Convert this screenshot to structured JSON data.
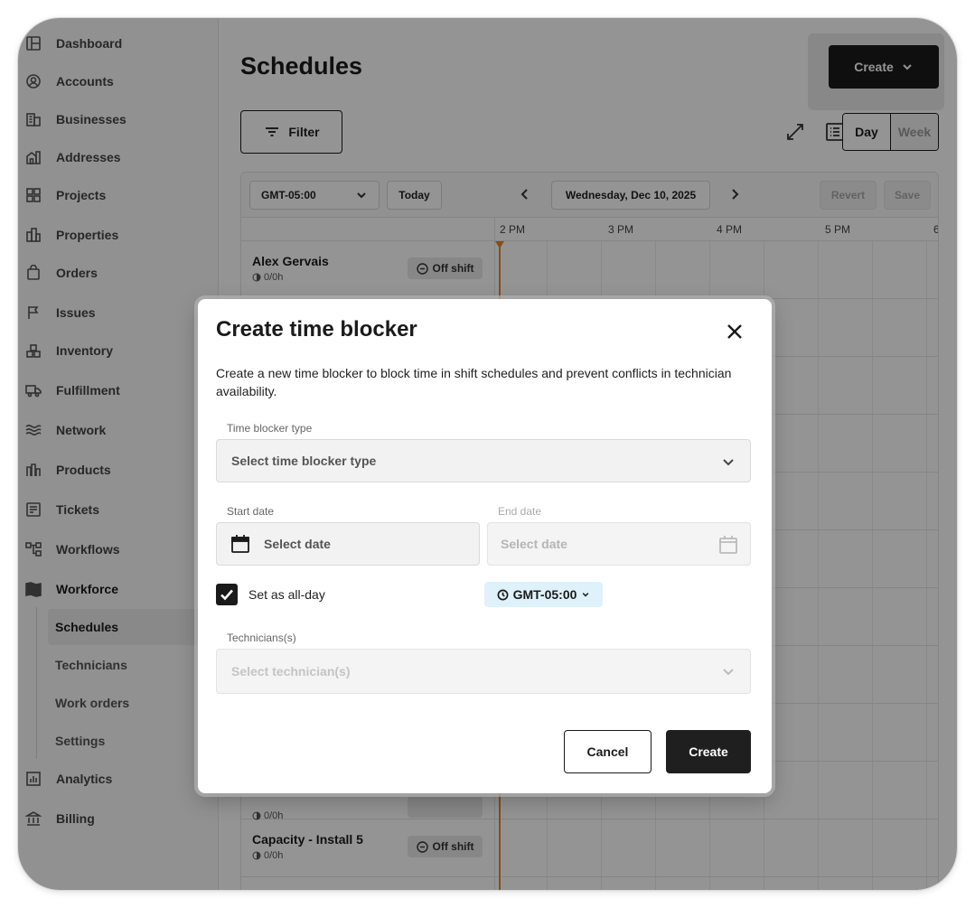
{
  "sidebar": {
    "items": [
      {
        "label": "Dashboard",
        "icon": "dashboard-icon"
      },
      {
        "label": "Accounts",
        "icon": "user-circle-icon"
      },
      {
        "label": "Businesses",
        "icon": "building-icon"
      },
      {
        "label": "Addresses",
        "icon": "house-icon"
      },
      {
        "label": "Projects",
        "icon": "grid-icon"
      },
      {
        "label": "Properties",
        "icon": "city-icon"
      },
      {
        "label": "Orders",
        "icon": "bag-icon"
      },
      {
        "label": "Issues",
        "icon": "flag-icon"
      },
      {
        "label": "Inventory",
        "icon": "boxes-icon"
      },
      {
        "label": "Fulfillment",
        "icon": "truck-icon"
      },
      {
        "label": "Network",
        "icon": "waves-icon"
      },
      {
        "label": "Products",
        "icon": "products-icon"
      },
      {
        "label": "Tickets",
        "icon": "ticket-icon"
      },
      {
        "label": "Workflows",
        "icon": "workflow-icon"
      },
      {
        "label": "Workforce",
        "icon": "map-icon"
      }
    ],
    "workforce_sub": [
      "Schedules",
      "Technicians",
      "Work orders",
      "Settings"
    ],
    "bottom_items": [
      {
        "label": "Analytics",
        "icon": "chart-icon"
      },
      {
        "label": "Billing",
        "icon": "bank-icon"
      }
    ]
  },
  "main": {
    "title": "Schedules",
    "create_label": "Create",
    "filter_label": "Filter",
    "view_day": "Day",
    "view_week": "Week",
    "timezone": "GMT-05:00",
    "today_label": "Today",
    "date_label": "Wednesday, Dec 10, 2025",
    "revert_label": "Revert",
    "save_label": "Save",
    "times": [
      "2 PM",
      "3 PM",
      "4 PM",
      "5 PM",
      "6"
    ],
    "rows": [
      {
        "name": "Alex Gervais",
        "hours": "0/0h",
        "status": "Off shift"
      },
      {
        "name": "",
        "hours": "0/0h",
        "status": ""
      },
      {
        "name": "Capacity - Install 5",
        "hours": "0/0h",
        "status": "Off shift"
      }
    ]
  },
  "modal": {
    "title": "Create time blocker",
    "description": "Create a new time blocker to block time in shift schedules and prevent conflicts in technician availability.",
    "type_label": "Time blocker type",
    "type_placeholder": "Select time blocker type",
    "start_label": "Start date",
    "start_placeholder": "Select date",
    "end_label": "End date",
    "end_placeholder": "Select date",
    "all_day_label": "Set as all-day",
    "all_day_checked": true,
    "timezone": "GMT-05:00",
    "technicians_label": "Technicians(s)",
    "technicians_placeholder": "Select technician(s)",
    "cancel_label": "Cancel",
    "create_label": "Create"
  }
}
